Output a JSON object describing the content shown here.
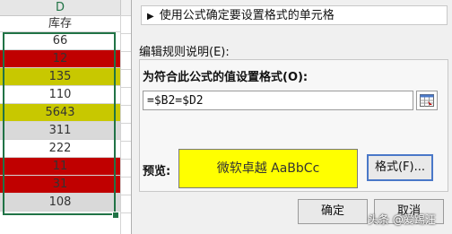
{
  "sheet": {
    "column_letter": "D",
    "header_cell": "库存",
    "rows": [
      {
        "value": "66",
        "fill": "none"
      },
      {
        "value": "12",
        "fill": "red"
      },
      {
        "value": "135",
        "fill": "yellow"
      },
      {
        "value": "110",
        "fill": "none"
      },
      {
        "value": "5643",
        "fill": "yellow"
      },
      {
        "value": "311",
        "fill": "gray"
      },
      {
        "value": "222",
        "fill": "none"
      },
      {
        "value": "11",
        "fill": "red"
      },
      {
        "value": "31",
        "fill": "red"
      },
      {
        "value": "108",
        "fill": "gray"
      }
    ]
  },
  "dialog": {
    "rule_type": "使用公式确定要设置格式的单元格",
    "description_label": "编辑规则说明(E):",
    "formula_label": "为符合此公式的值设置格式(O):",
    "formula_value": "=$B2=$D2",
    "preview_label": "预览:",
    "preview_text": "微软卓越  AaBbCc",
    "format_button": "格式(F)...",
    "ok_button": "确定",
    "cancel_button": "取消"
  },
  "watermark": "头条 @爱踢汪",
  "colors": {
    "red_fill": "#c00000",
    "yellow_fill": "#c8c800",
    "gray_fill": "#d9d9d9",
    "preview_fill": "#ffff00",
    "selection_border": "#217346",
    "focus_border": "#4a78c8"
  },
  "icons": {
    "expand": "triangle-right-icon",
    "range_picker": "range-picker-icon"
  }
}
